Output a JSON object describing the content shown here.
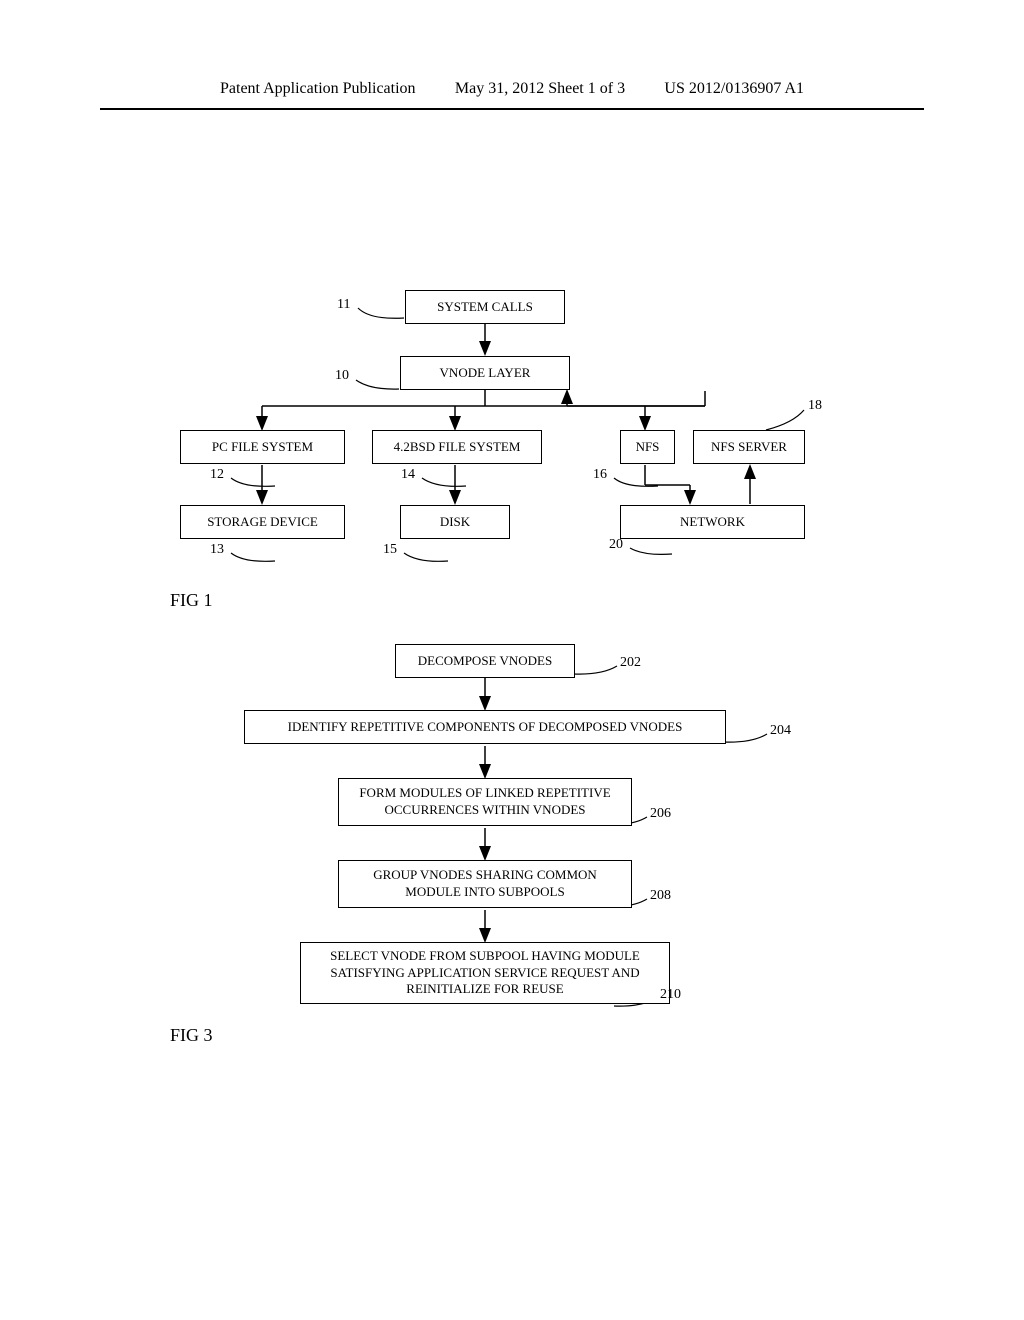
{
  "header": {
    "left": "Patent Application Publication",
    "center": "May 31, 2012  Sheet 1 of 3",
    "right": "US 2012/0136907 A1"
  },
  "fig1": {
    "system_calls": "SYSTEM CALLS",
    "vnode_layer": "VNODE LAYER",
    "pc_file_system": "PC FILE SYSTEM",
    "bsd_file_system": "4.2BSD FILE SYSTEM",
    "nfs": "NFS",
    "nfs_server": "NFS SERVER",
    "storage_device": "STORAGE DEVICE",
    "disk": "DISK",
    "network": "NETWORK",
    "labels": {
      "n10": "10",
      "n11": "11",
      "n12": "12",
      "n13": "13",
      "n14": "14",
      "n15": "15",
      "n16": "16",
      "n18": "18",
      "n20": "20"
    },
    "caption": "FIG 1"
  },
  "fig3": {
    "step_202": "DECOMPOSE VNODES",
    "step_204": "IDENTIFY REPETITIVE COMPONENTS OF DECOMPOSED VNODES",
    "step_206": "FORM MODULES OF LINKED REPETITIVE OCCURRENCES WITHIN VNODES",
    "step_208": "GROUP VNODES SHARING COMMON MODULE INTO SUBPOOLS",
    "step_210": "SELECT VNODE FROM SUBPOOL HAVING MODULE SATISFYING APPLICATION SERVICE REQUEST AND REINITIALIZE FOR REUSE",
    "labels": {
      "n202": "202",
      "n204": "204",
      "n206": "206",
      "n208": "208",
      "n210": "210"
    },
    "caption": "FIG 3"
  }
}
